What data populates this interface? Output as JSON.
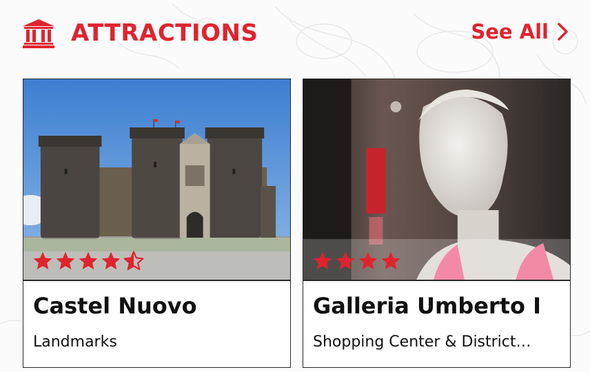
{
  "header": {
    "title": "ATTRACTIONS",
    "see_all_label": "See All",
    "icon": "museum-icon"
  },
  "colors": {
    "accent": "#e0232e",
    "star": "#e0232e",
    "border": "#2a2a2a",
    "background": "#fbfbfb"
  },
  "cards": [
    {
      "name": "Castel Nuovo",
      "category": "Landmarks",
      "rating": 4.5,
      "image": "castle-photo"
    },
    {
      "name": "Galleria Umberto I",
      "category": "Shopping Center & District…",
      "rating": 4,
      "image": "mannequin-photo"
    }
  ]
}
